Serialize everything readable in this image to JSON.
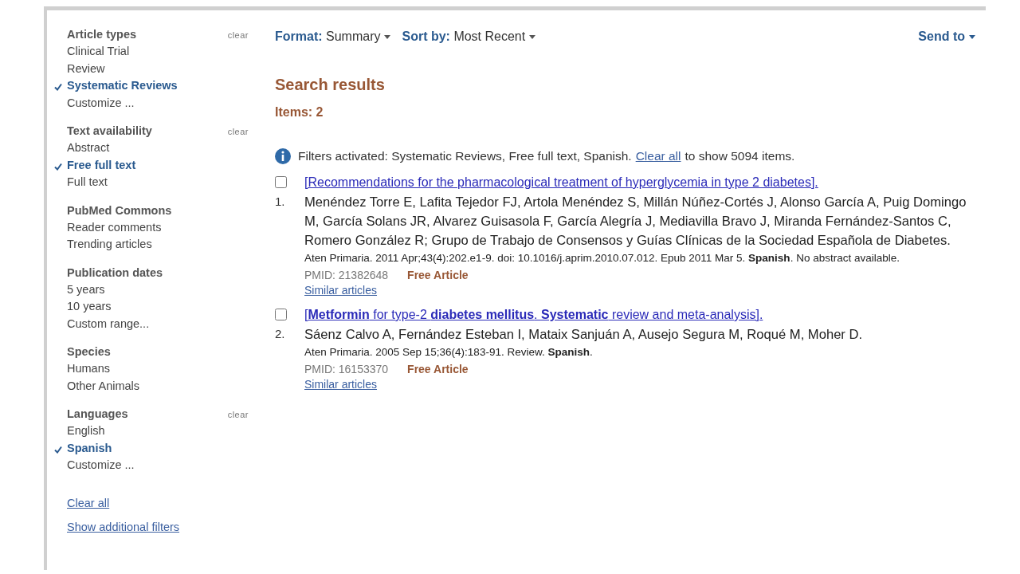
{
  "sidebar": {
    "groups": [
      {
        "title": "Article types",
        "clear": "clear",
        "items": [
          {
            "label": "Clinical Trial",
            "selected": false
          },
          {
            "label": "Review",
            "selected": false
          },
          {
            "label": "Systematic Reviews",
            "selected": true
          },
          {
            "label": "Customize ...",
            "selected": false
          }
        ]
      },
      {
        "title": "Text availability",
        "clear": "clear",
        "items": [
          {
            "label": "Abstract",
            "selected": false
          },
          {
            "label": "Free full text",
            "selected": true
          },
          {
            "label": "Full text",
            "selected": false
          }
        ]
      },
      {
        "title": "PubMed Commons",
        "items": [
          {
            "label": "Reader comments",
            "selected": false
          },
          {
            "label": "Trending articles",
            "selected": false
          }
        ]
      },
      {
        "title": "Publication dates",
        "items": [
          {
            "label": "5 years",
            "selected": false
          },
          {
            "label": "10 years",
            "selected": false
          },
          {
            "label": "Custom range...",
            "selected": false
          }
        ]
      },
      {
        "title": "Species",
        "items": [
          {
            "label": "Humans",
            "selected": false
          },
          {
            "label": "Other Animals",
            "selected": false
          }
        ]
      },
      {
        "title": "Languages",
        "clear": "clear",
        "items": [
          {
            "label": "English",
            "selected": false
          },
          {
            "label": "Spanish",
            "selected": true
          },
          {
            "label": "Customize ...",
            "selected": false
          }
        ]
      }
    ],
    "clear_all": "Clear all",
    "show_additional": "Show additional filters"
  },
  "toolbar": {
    "format_label": "Format:",
    "format_value": "Summary",
    "sort_label": "Sort by:",
    "sort_value": "Most Recent",
    "send_to": "Send to"
  },
  "heading": "Search results",
  "items_count": "Items: 2",
  "filter_notice": {
    "prefix": "Filters activated: Systematic Reviews, Free full text, Spanish.",
    "link": "Clear all",
    "suffix": "to show 5094 items."
  },
  "results": [
    {
      "number": "1.",
      "checked": false,
      "title": "[Recommendations for the pharmacological treatment of hyperglycemia in type 2 diabetes].",
      "authors": "Menéndez Torre E, Lafita Tejedor FJ, Artola Menéndez S, Millán Núñez-Cortés J, Alonso García A, Puig Domingo M, García Solans JR, Alvarez Guisasola F, García Alegría J, Mediavilla Bravo J, Miranda Fernández-Santos C, Romero González R; Grupo de Trabajo de Consensos y Guías Clínicas de la Sociedad Española de Diabetes.",
      "source": "Aten Primaria. 2011 Apr;43(4):202.e1-9. doi: 10.1016/j.aprim.2010.07.012. Epub 2011 Mar 5. **Spanish**. No abstract available.",
      "pmid": "PMID: 21382648",
      "free": "Free Article",
      "similar": "Similar articles"
    },
    {
      "number": "2.",
      "checked": false,
      "title": "[**Metformin** for type-2 **diabetes mellitus**. **Systematic** review and meta-analysis].",
      "authors": "Sáenz Calvo A, Fernández Esteban I, Mataix Sanjuán A, Ausejo Segura M, Roqué M, Moher D.",
      "source": "Aten Primaria. 2005 Sep 15;36(4):183-91. Review. **Spanish**.",
      "pmid": "PMID: 16153370",
      "free": "Free Article",
      "similar": "Similar articles"
    }
  ]
}
